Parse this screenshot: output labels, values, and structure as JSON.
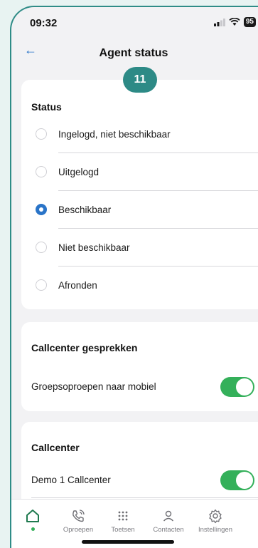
{
  "status_bar": {
    "time": "09:32",
    "battery": "95"
  },
  "header": {
    "title": "Agent status",
    "back_icon": "arrow-left-icon"
  },
  "badge": "11",
  "status_card": {
    "title": "Status",
    "options": [
      {
        "label": "Ingelogd, niet beschikbaar",
        "selected": false
      },
      {
        "label": "Uitgelogd",
        "selected": false
      },
      {
        "label": "Beschikbaar",
        "selected": true
      },
      {
        "label": "Niet beschikbaar",
        "selected": false
      },
      {
        "label": "Afronden",
        "selected": false
      }
    ]
  },
  "callcenter_calls_card": {
    "title": "Callcenter gesprekken",
    "toggle_label": "Groepsoproepen naar mobiel",
    "toggle_on": true
  },
  "callcenter_card": {
    "title": "Callcenter",
    "toggle_label": "Demo 1 Callcenter",
    "toggle_on": true
  },
  "tabbar": {
    "tabs": [
      {
        "label": "",
        "icon": "home-icon",
        "active": true
      },
      {
        "label": "Oproepen",
        "icon": "phone-icon",
        "active": false
      },
      {
        "label": "Toetsen",
        "icon": "keypad-icon",
        "active": false
      },
      {
        "label": "Contacten",
        "icon": "person-icon",
        "active": false
      },
      {
        "label": "Instellingen",
        "icon": "gear-icon",
        "active": false
      }
    ]
  },
  "colors": {
    "accent": "#2a74c8",
    "toggle_on": "#34b05a",
    "badge": "#2d8a86",
    "frame": "#2f8c87"
  }
}
